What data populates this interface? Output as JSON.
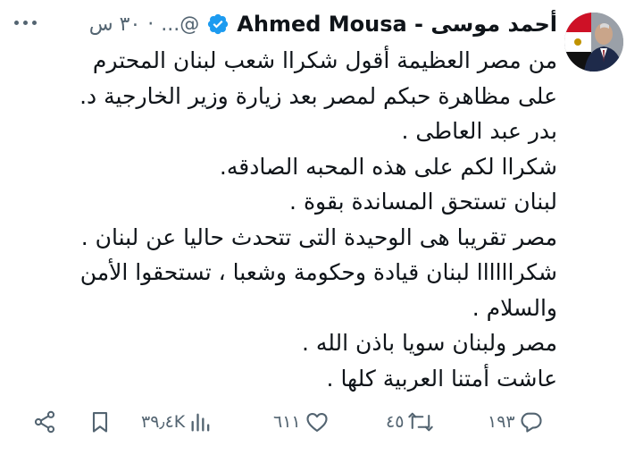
{
  "tweet": {
    "author_name": "أحمد موسى - Ahmed Mousa",
    "handle": "@...",
    "separator": "·",
    "time": "٣٠ س",
    "lines": [
      "من مصر العظيمة أقول شكراا شعب لبنان المحترم",
      "على مظاهرة حبكم لمصر بعد زيارة وزير الخارجية د.",
      "بدر عبد العاطى .",
      "شكراا لكم على هذه المحبه الصادقه.",
      "لبنان تستحق المساندة بقوة .",
      "مصر تقريبا هى الوحيدة التى تتحدث حاليا عن لبنان .",
      "شكراااااا لبنان قيادة وحكومة وشعبا ، تستحقوا الأمن",
      "والسلام .",
      "مصر ولبنان سويا باذن الله .",
      "عاشت أمتنا العربية كلها ."
    ]
  },
  "actions": {
    "replies": "١٩٣",
    "reposts": "٤٥",
    "likes": "٦١١",
    "views": "٣٩٫٤K"
  },
  "colors": {
    "verified": "#1d9bf0",
    "muted": "#536471",
    "text": "#0f1419"
  },
  "icons": [
    "verified-badge-icon",
    "more-options-icon",
    "reply-icon",
    "repost-icon",
    "like-icon",
    "views-icon",
    "bookmark-icon",
    "share-icon"
  ]
}
